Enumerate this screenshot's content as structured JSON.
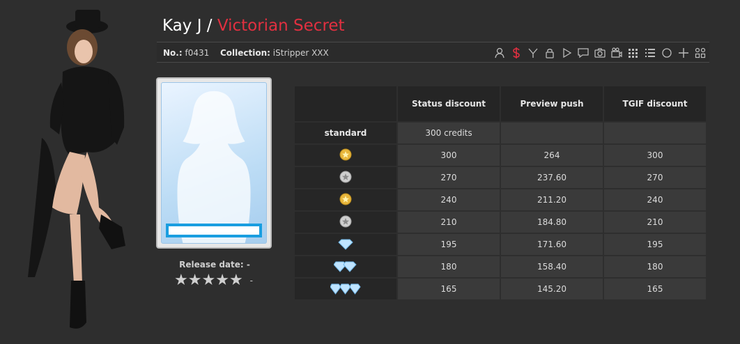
{
  "header": {
    "model_name": "Kay J",
    "separator": "/",
    "collection_title": "Victorian Secret"
  },
  "meta": {
    "no_label": "No.:",
    "no_value": "f0431",
    "collection_label": "Collection:",
    "collection_value": "iStripper XXX"
  },
  "toolbar_icons": [
    "model-icon",
    "dollar-icon",
    "filter-icon",
    "lock-icon",
    "play-icon",
    "comment-icon",
    "camera-icon",
    "video-camera-icon",
    "grid-icon",
    "list-icon",
    "circle-icon",
    "plus-icon",
    "gallery-icon"
  ],
  "release": {
    "label": "Release date: -",
    "rating_stars": 0,
    "rating_text": "-"
  },
  "prices": {
    "headers": [
      "",
      "Status discount",
      "Preview push",
      "TGIF discount"
    ],
    "rows": [
      {
        "level": "standard",
        "badge": null,
        "values": [
          "300 credits",
          "",
          ""
        ]
      },
      {
        "level": "",
        "badge": "gold-star-icon",
        "values": [
          "300",
          "264",
          "300"
        ]
      },
      {
        "level": "",
        "badge": "silver-star-icon",
        "values": [
          "270",
          "237.60",
          "270"
        ]
      },
      {
        "level": "",
        "badge": "gold-star-icon",
        "values": [
          "240",
          "211.20",
          "240"
        ]
      },
      {
        "level": "",
        "badge": "silver-star-icon",
        "values": [
          "210",
          "184.80",
          "210"
        ]
      },
      {
        "level": "",
        "badge": "diamond-1-icon",
        "values": [
          "195",
          "171.60",
          "195"
        ]
      },
      {
        "level": "",
        "badge": "diamond-2-icon",
        "values": [
          "180",
          "158.40",
          "180"
        ]
      },
      {
        "level": "",
        "badge": "diamond-3-icon",
        "values": [
          "165",
          "145.20",
          "165"
        ]
      }
    ]
  },
  "colors": {
    "background": "#2e2e2e",
    "accent_red": "#e03040",
    "card_blue": "#1a9ee0"
  }
}
